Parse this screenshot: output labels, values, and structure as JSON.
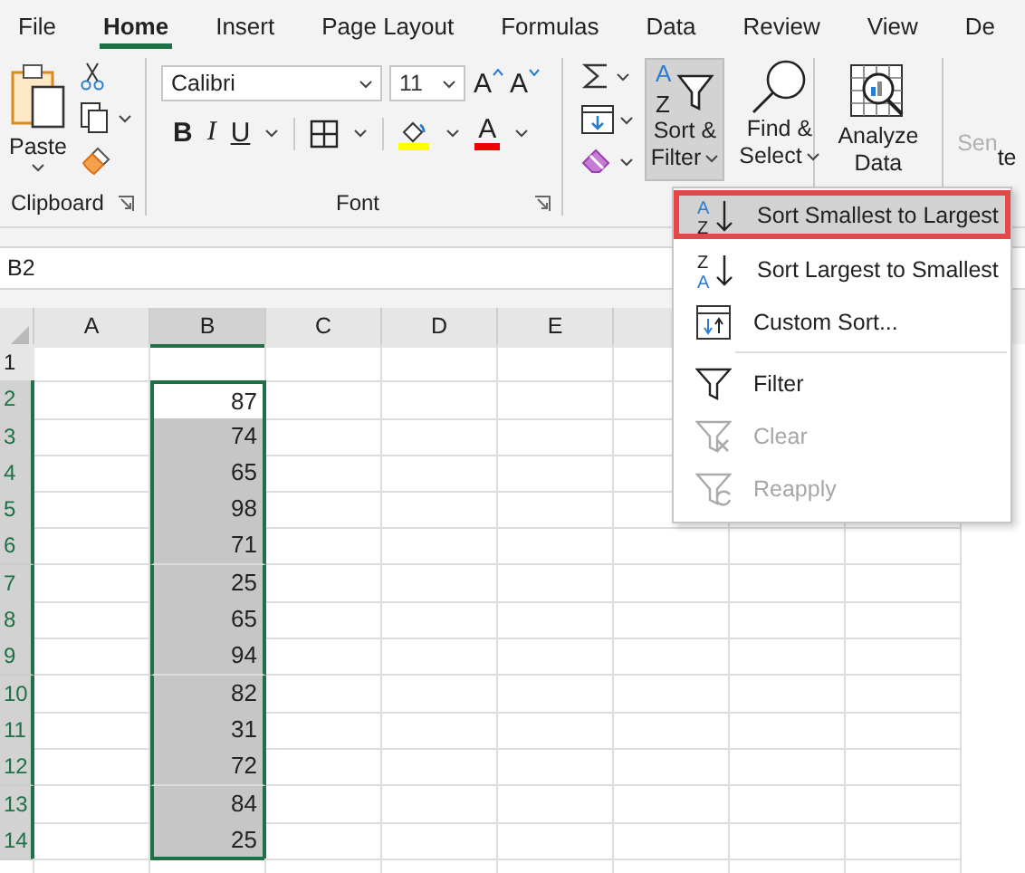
{
  "tabs": [
    {
      "label": "File",
      "selected": false
    },
    {
      "label": "Home",
      "selected": true
    },
    {
      "label": "Insert",
      "selected": false
    },
    {
      "label": "Page Layout",
      "selected": false
    },
    {
      "label": "Formulas",
      "selected": false
    },
    {
      "label": "Data",
      "selected": false
    },
    {
      "label": "Review",
      "selected": false
    },
    {
      "label": "View",
      "selected": false
    },
    {
      "label": "De",
      "selected": false
    }
  ],
  "clipboard": {
    "paste_label": "Paste",
    "group_label": "Clipboard"
  },
  "font": {
    "font_name": "Calibri",
    "font_size": "11",
    "grow_label": "A",
    "shrink_label": "A",
    "bold_label": "B",
    "italic_label": "I",
    "underline_label": "U",
    "font_color_label": "A",
    "group_label": "Font"
  },
  "editing": {
    "sort_filter": {
      "label_1": "Sort &",
      "label_2": "Filter",
      "icon_text": [
        "A",
        "Z"
      ],
      "active": true
    },
    "find_select": {
      "label_1": "Find &",
      "label_2": "Select"
    }
  },
  "analyze": {
    "label_1": "Analyze",
    "label_2": "Data"
  },
  "sensitivity": {
    "label": "Sen",
    "disabled": true
  },
  "fragment": "te",
  "name_box": "B2",
  "columns": [
    {
      "label": "A",
      "selected": false
    },
    {
      "label": "B",
      "selected": true
    },
    {
      "label": "C",
      "selected": false
    },
    {
      "label": "D",
      "selected": false
    },
    {
      "label": "E",
      "selected": false
    }
  ],
  "rows": [
    {
      "number": "1",
      "selected": false,
      "b": ""
    },
    {
      "number": "2",
      "selected": true,
      "b": "87"
    },
    {
      "number": "3",
      "selected": true,
      "b": "74"
    },
    {
      "number": "4",
      "selected": true,
      "b": "65"
    },
    {
      "number": "5",
      "selected": true,
      "b": "98"
    },
    {
      "number": "6",
      "selected": true,
      "b": "71"
    },
    {
      "number": "7",
      "selected": true,
      "b": "25"
    },
    {
      "number": "8",
      "selected": true,
      "b": "65"
    },
    {
      "number": "9",
      "selected": true,
      "b": "94"
    },
    {
      "number": "10",
      "selected": true,
      "b": "82"
    },
    {
      "number": "11",
      "selected": true,
      "b": "31"
    },
    {
      "number": "12",
      "selected": true,
      "b": "72"
    },
    {
      "number": "13",
      "selected": true,
      "b": "84"
    },
    {
      "number": "14",
      "selected": true,
      "b": "25"
    }
  ],
  "menu": [
    {
      "kind": "sort_asc",
      "label": "Sort Smallest to Largest",
      "icon_text": [
        "A",
        "Z"
      ],
      "selected": true,
      "disabled": false
    },
    {
      "kind": "sort_desc",
      "label": "Sort Largest to Smallest",
      "icon_text": [
        "Z",
        "A"
      ],
      "selected": false,
      "disabled": false
    },
    {
      "kind": "custom",
      "label": "Custom Sort...",
      "selected": false,
      "disabled": false
    },
    {
      "kind": "filter",
      "label": "Filter",
      "selected": false,
      "disabled": false
    },
    {
      "kind": "clear",
      "label": "Clear",
      "selected": false,
      "disabled": true
    },
    {
      "kind": "reapply",
      "label": "Reapply",
      "selected": false,
      "disabled": true
    }
  ]
}
